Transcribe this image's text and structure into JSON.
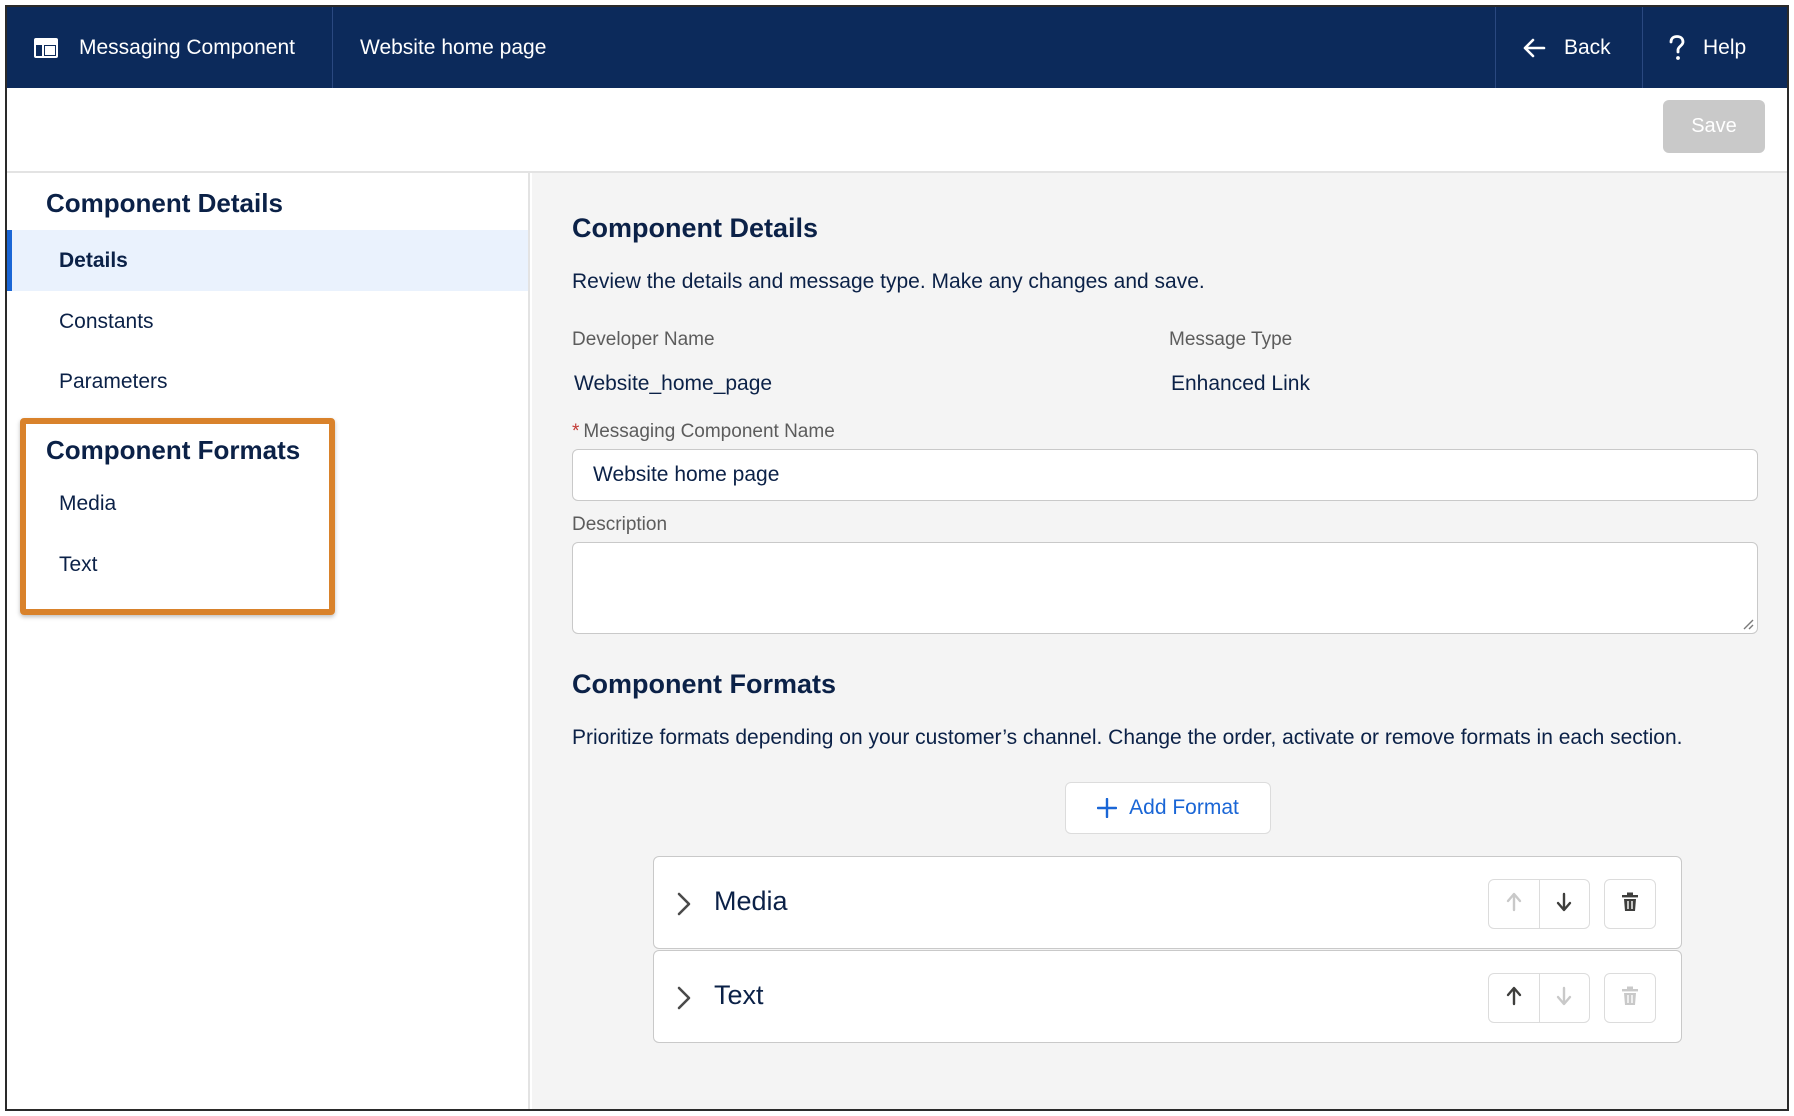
{
  "header": {
    "app_title": "Messaging Component",
    "record_title": "Website home page",
    "back_label": "Back",
    "help_label": "Help",
    "app_icon": "table-icon",
    "back_icon": "arrow-left-icon",
    "help_icon": "question-icon"
  },
  "toolbar": {
    "save_label": "Save"
  },
  "sidebar": {
    "section1_title": "Component Details",
    "section1_items": [
      {
        "label": "Details",
        "active": true
      },
      {
        "label": "Constants"
      },
      {
        "label": "Parameters"
      }
    ],
    "section2_title": "Component Formats",
    "section2_items": [
      {
        "label": "Media"
      },
      {
        "label": "Text"
      }
    ],
    "highlight_color": "#d9822b"
  },
  "main": {
    "details_title": "Component Details",
    "details_desc": "Review the details and message type. Make any changes and save.",
    "developer_name_label": "Developer Name",
    "developer_name_value": "Website_home_page",
    "message_type_label": "Message Type",
    "message_type_value": "Enhanced Link",
    "name_required_marker": "*",
    "name_label": "Messaging Component Name",
    "name_value": "Website home page",
    "description_label": "Description",
    "description_value": "",
    "formats_title": "Component Formats",
    "formats_desc": "Prioritize formats depending on your customer’s channel. Change the order, activate or remove formats in each section.",
    "add_format_label": "Add Format",
    "formats": [
      {
        "label": "Media",
        "up_enabled": false,
        "down_enabled": true,
        "delete_enabled": true
      },
      {
        "label": "Text",
        "up_enabled": true,
        "down_enabled": false,
        "delete_enabled": false
      }
    ]
  },
  "colors": {
    "header_bg": "#0c2a5b",
    "accent": "#1a66d6",
    "text": "#0b2147",
    "save_disabled": "#c9c9c9",
    "required": "#c23934"
  }
}
